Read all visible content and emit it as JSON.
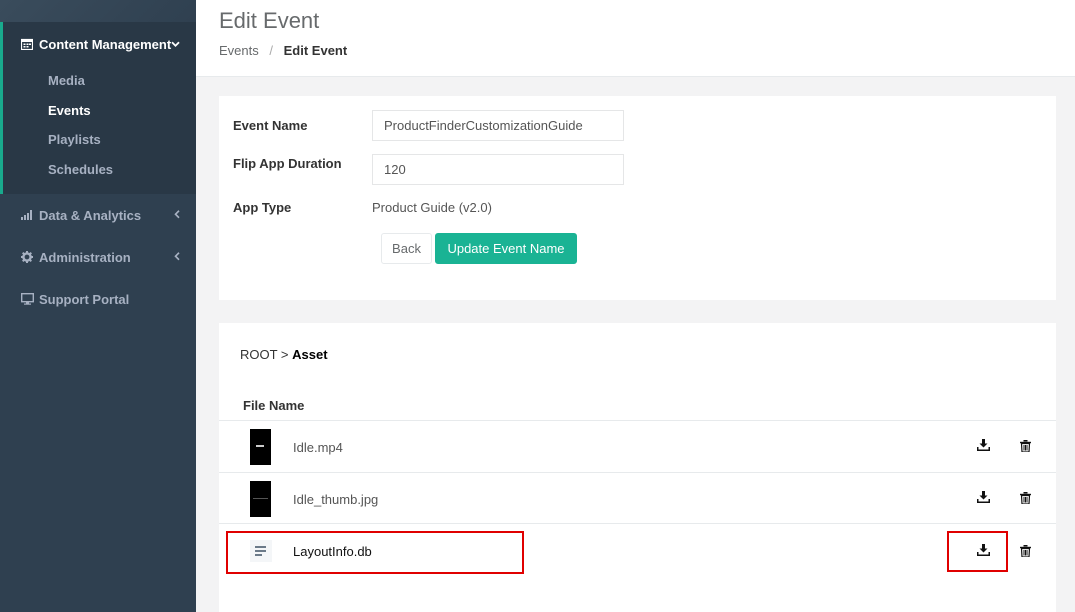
{
  "sidebar": {
    "content_management": "Content Management",
    "sub_items": [
      "Media",
      "Events",
      "Playlists",
      "Schedules"
    ],
    "data_analytics": "Data & Analytics",
    "administration": "Administration",
    "support_portal": "Support Portal"
  },
  "header": {
    "title": "Edit Event",
    "breadcrumb_root": "Events",
    "breadcrumb_sep": "/",
    "breadcrumb_current": "Edit Event"
  },
  "form": {
    "event_name_label": "Event Name",
    "event_name_value": "ProductFinderCustomizationGuide",
    "duration_label": "Flip App Duration",
    "duration_value": "120",
    "app_type_label": "App Type",
    "app_type_value": "Product Guide (v2.0)",
    "back_label": "Back",
    "update_label": "Update Event Name"
  },
  "files": {
    "path_root": "ROOT >",
    "path_current": "Asset",
    "column_header": "File Name",
    "rows": [
      {
        "name": "Idle.mp4"
      },
      {
        "name": "Idle_thumb.jpg"
      },
      {
        "name": "LayoutInfo.db"
      }
    ]
  },
  "colors": {
    "sidebar_bg": "#2f4050",
    "accent": "#1ab394",
    "highlight": "#e00000"
  }
}
